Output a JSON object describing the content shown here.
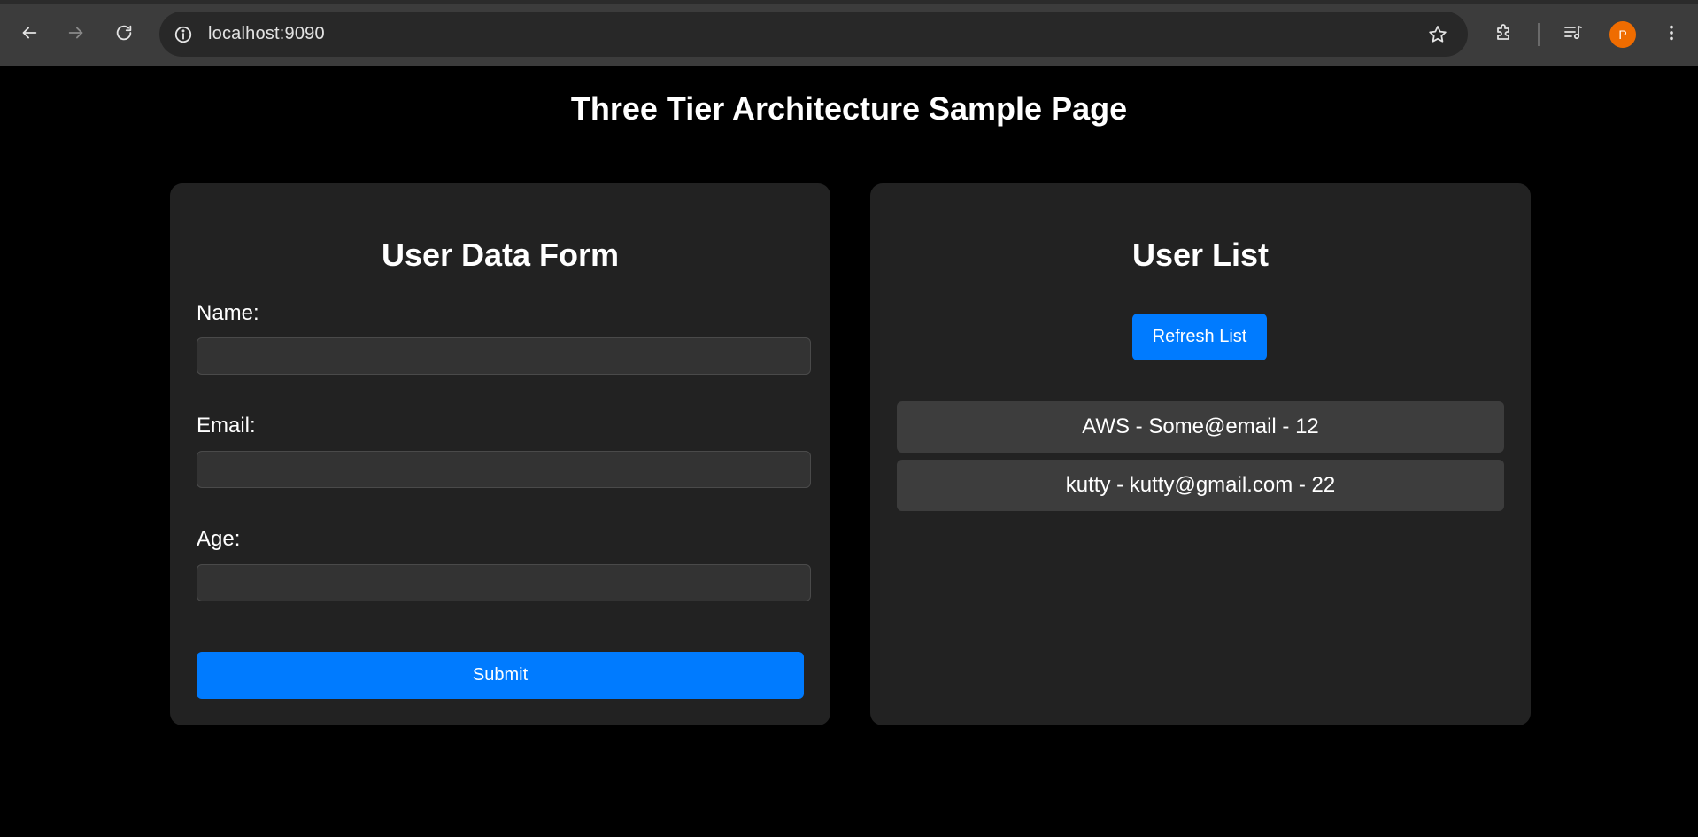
{
  "browser": {
    "url": "localhost:9090",
    "profile_initial": "P",
    "profile_color": "#ef6c00",
    "icons": {
      "back": "back-arrow-icon",
      "forward": "forward-arrow-icon",
      "reload": "reload-icon",
      "site_info": "info-icon",
      "bookmark": "star-icon",
      "extensions": "puzzle-icon",
      "media": "media-queue-icon",
      "menu": "kebab-menu-icon"
    }
  },
  "page": {
    "title": "Three Tier Architecture Sample Page"
  },
  "form": {
    "title": "User Data Form",
    "name_label": "Name:",
    "name_value": "",
    "email_label": "Email:",
    "email_value": "",
    "age_label": "Age:",
    "age_value": "",
    "submit_label": "Submit"
  },
  "user_list": {
    "title": "User List",
    "refresh_label": "Refresh List",
    "items": [
      "AWS - Some@email - 12",
      "kutty - kutty@gmail.com - 22"
    ]
  },
  "colors": {
    "accent": "#007bff",
    "card_bg": "#222222",
    "page_bg": "#000000",
    "item_bg": "#3d3d3d"
  }
}
